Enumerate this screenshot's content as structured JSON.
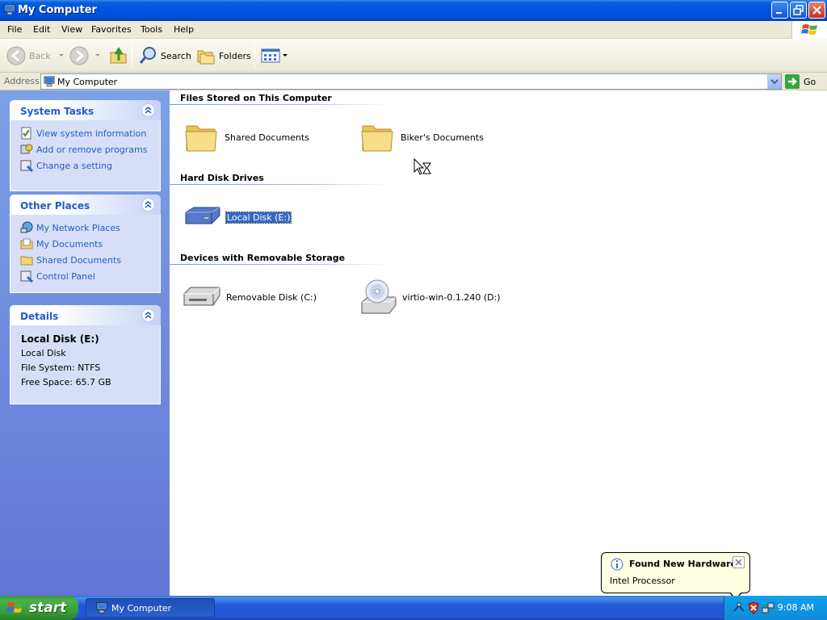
{
  "window": {
    "title": "My Computer"
  },
  "menu": [
    "File",
    "Edit",
    "View",
    "Favorites",
    "Tools",
    "Help"
  ],
  "toolbar": {
    "back_label": "Back",
    "search_label": "Search",
    "folders_label": "Folders"
  },
  "address": {
    "label": "Address",
    "value": "My Computer",
    "go_label": "Go"
  },
  "sidebar": {
    "system_tasks": {
      "title": "System Tasks",
      "items": [
        "View system information",
        "Add or remove programs",
        "Change a setting"
      ]
    },
    "other_places": {
      "title": "Other Places",
      "items": [
        "My Network Places",
        "My Documents",
        "Shared Documents",
        "Control Panel"
      ]
    },
    "details": {
      "title": "Details",
      "name": "Local Disk (E:)",
      "type": "Local Disk",
      "file_system": "File System: NTFS",
      "free_space": "Free Space: 65.7 GB"
    }
  },
  "main": {
    "groups": [
      {
        "title": "Files Stored on This Computer",
        "items": [
          "Shared Documents",
          "Biker's Documents"
        ]
      },
      {
        "title": "Hard Disk Drives",
        "items": [
          "Local Disk (E:)"
        ]
      },
      {
        "title": "Devices with Removable Storage",
        "items": [
          "Removable Disk (C:)",
          "virtio-win-0.1.240 (D:)"
        ]
      }
    ]
  },
  "taskbar": {
    "start_label": "start",
    "task_label": "My Computer",
    "clock": "9:08 AM"
  },
  "balloon": {
    "title": "Found New Hardware",
    "text": "Intel Processor"
  },
  "colors": {
    "titlebar": "#0054e3",
    "taskpane": "#6f8fdf",
    "link": "#215dc6",
    "selection": "#316ac5",
    "start_green": "#3c9a3c"
  }
}
